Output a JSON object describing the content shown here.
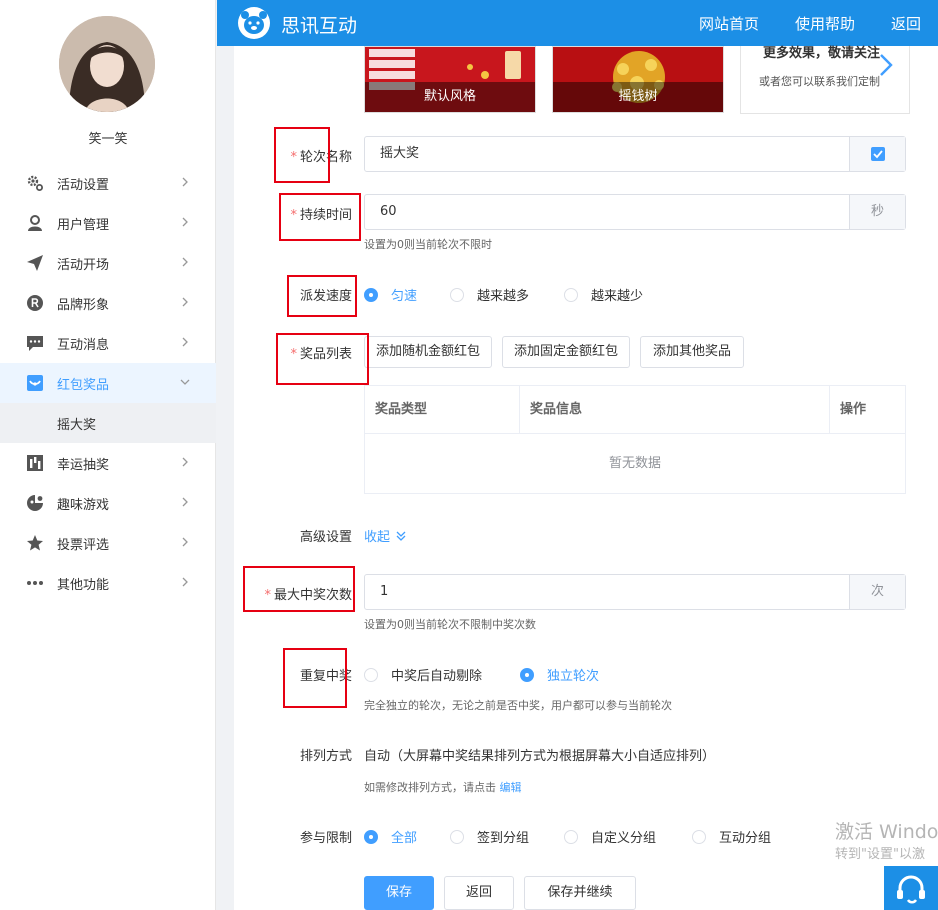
{
  "user": {
    "name": "笑一笑"
  },
  "sidebar": {
    "items": [
      {
        "label": "活动设置",
        "icon": "gear-icon"
      },
      {
        "label": "用户管理",
        "icon": "user-icon"
      },
      {
        "label": "活动开场",
        "icon": "paper-plane-icon"
      },
      {
        "label": "品牌形象",
        "icon": "registered-icon"
      },
      {
        "label": "互动消息",
        "icon": "chat-icon"
      },
      {
        "label": "红包奖品",
        "icon": "gift-box-icon",
        "active": true
      },
      {
        "label": "幸运抽奖",
        "icon": "lottery-icon"
      },
      {
        "label": "趣味游戏",
        "icon": "game-icon"
      },
      {
        "label": "投票评选",
        "icon": "star-icon"
      },
      {
        "label": "其他功能",
        "icon": "more-dots-icon"
      }
    ],
    "sub_item": "摇大奖"
  },
  "header": {
    "brand": "思讯互动",
    "nav_home": "网站首页",
    "nav_help": "使用帮助",
    "nav_back": "返回"
  },
  "themes": {
    "default": "默认风格",
    "money_tree": "摇钱树",
    "more_title": "更多效果，敬请关注",
    "more_sub": "或者您可以联系我们定制"
  },
  "form": {
    "round_name": {
      "label": "轮次名称",
      "value": "摇大奖"
    },
    "duration": {
      "label": "持续时间",
      "value": "60",
      "unit": "秒",
      "hint": "设置为0则当前轮次不限时"
    },
    "speed": {
      "label": "派发速度",
      "options": [
        "匀速",
        "越来越多",
        "越来越少"
      ],
      "selected": "匀速"
    },
    "prize_list": {
      "label": "奖品列表",
      "buttons": [
        "添加随机金额红包",
        "添加固定金额红包",
        "添加其他奖品"
      ],
      "columns": [
        "奖品类型",
        "奖品信息",
        "操作"
      ],
      "empty": "暂无数据"
    },
    "advanced": {
      "label": "高级设置",
      "toggle": "收起"
    },
    "max_wins": {
      "label": "最大中奖次数",
      "value": "1",
      "unit": "次",
      "hint": "设置为0则当前轮次不限制中奖次数"
    },
    "repeat_win": {
      "label": "重复中奖",
      "options": [
        "中奖后自动剔除",
        "独立轮次"
      ],
      "selected": "独立轮次",
      "hint": "完全独立的轮次，无论之前是否中奖，用户都可以参与当前轮次"
    },
    "sort": {
      "label": "排列方式",
      "value": "自动（大屏幕中奖结果排列方式为根据屏幕大小自适应排列）",
      "hint": "如需修改排列方式，请点击",
      "link": "编辑"
    },
    "limit": {
      "label": "参与限制",
      "options": [
        "全部",
        "签到分组",
        "自定义分组",
        "互动分组"
      ],
      "selected": "全部"
    },
    "actions": {
      "save": "保存",
      "back": "返回",
      "save_continue": "保存并继续"
    }
  },
  "watermark": {
    "line1": "激活 Windo",
    "line2": "转到\"设置\"以激"
  },
  "colors": {
    "primary": "#409eff",
    "header": "#1c8fe6",
    "required": "#f56c6c",
    "annotation": "#e60012"
  }
}
